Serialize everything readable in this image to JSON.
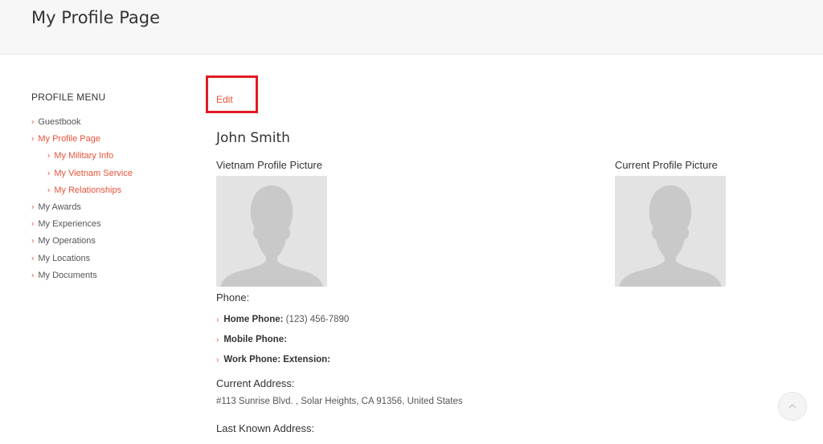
{
  "header": {
    "title": "My Profile Page"
  },
  "sidebar": {
    "heading": "PROFILE MENU",
    "items": [
      {
        "label": "Guestbook"
      },
      {
        "label": "My Profile Page"
      },
      {
        "label": "My Military Info"
      },
      {
        "label": "My Vietnam Service"
      },
      {
        "label": "My Relationships"
      },
      {
        "label": "My Awards"
      },
      {
        "label": "My Experiences"
      },
      {
        "label": "My Operations"
      },
      {
        "label": "My Locations"
      },
      {
        "label": "My Documents"
      }
    ]
  },
  "main": {
    "edit_label": "Edit",
    "name": "John Smith",
    "vietnam_picture_label": "Vietnam Profile Picture",
    "current_picture_label": "Current Profile Picture",
    "phone": {
      "label": "Phone:",
      "home_label": "Home Phone:",
      "home_value": "(123) 456-7890",
      "mobile_label": "Mobile Phone:",
      "mobile_value": "",
      "work_label": "Work Phone: Extension:",
      "work_value": ""
    },
    "current_address_label": "Current Address:",
    "current_address": "#113 Sunrise Blvd. , Solar Heights, CA 91356, United States",
    "last_address_label": "Last Known Address:"
  },
  "colors": {
    "accent": "#e8533a",
    "highlight_box": "#e01b24",
    "header_bg": "#f7f7f7"
  },
  "icons": {
    "menu_bullet": "chevron-right-icon",
    "scroll_top": "chevron-up-icon"
  }
}
